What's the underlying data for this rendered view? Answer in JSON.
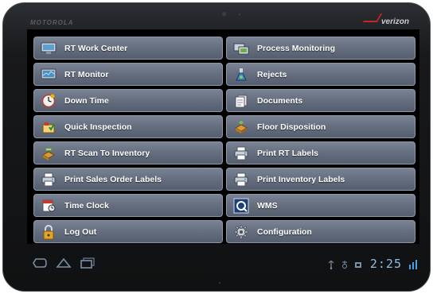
{
  "device": {
    "brand": "MOTOROLA",
    "carrier": "verizon"
  },
  "menu": {
    "items": [
      {
        "label": "RT Work Center",
        "icon": "monitor-icon"
      },
      {
        "label": "Process Monitoring",
        "icon": "monitoring-icon"
      },
      {
        "label": "RT Monitor",
        "icon": "display-icon"
      },
      {
        "label": "Rejects",
        "icon": "flask-icon"
      },
      {
        "label": "Down Time",
        "icon": "clock-icon"
      },
      {
        "label": "Documents",
        "icon": "documents-icon"
      },
      {
        "label": "Quick Inspection",
        "icon": "inspection-icon"
      },
      {
        "label": "Floor Disposition",
        "icon": "floor-icon"
      },
      {
        "label": "RT Scan To Inventory",
        "icon": "scan-icon"
      },
      {
        "label": "Print RT Labels",
        "icon": "printer-icon"
      },
      {
        "label": "Print Sales Order Labels",
        "icon": "printer-icon"
      },
      {
        "label": "Print Inventory Labels",
        "icon": "printer-icon"
      },
      {
        "label": "Time Clock",
        "icon": "time-clock-icon"
      },
      {
        "label": "WMS",
        "icon": "wms-icon"
      },
      {
        "label": "Log Out",
        "icon": "lock-icon"
      },
      {
        "label": "Configuration",
        "icon": "gear-icon"
      }
    ]
  },
  "status_bar": {
    "time": "2:25"
  },
  "colors": {
    "button_top": "#7a8393",
    "button_bottom": "#555e6e",
    "status_accent": "#8fbfe8"
  }
}
